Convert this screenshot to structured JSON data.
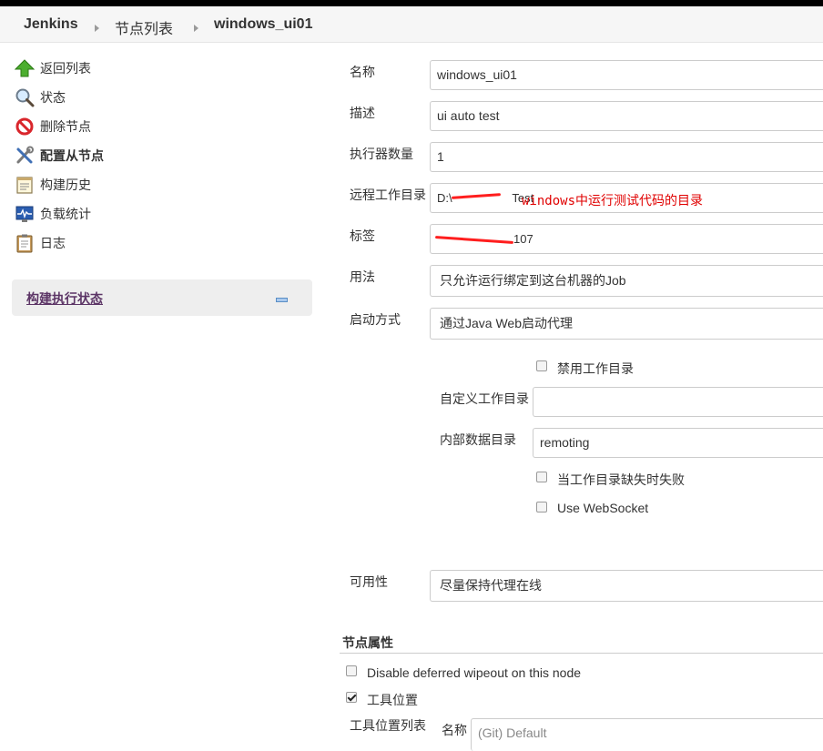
{
  "breadcrumb": {
    "items": [
      "Jenkins",
      "节点列表",
      "windows_ui01"
    ]
  },
  "sidebar": {
    "items": [
      {
        "label": "返回列表",
        "icon": "up-arrow-icon"
      },
      {
        "label": "状态",
        "icon": "magnifier-icon"
      },
      {
        "label": "删除节点",
        "icon": "no-entry-icon"
      },
      {
        "label": "配置从节点",
        "icon": "tools-icon"
      },
      {
        "label": "构建历史",
        "icon": "notepad-icon"
      },
      {
        "label": "负载统计",
        "icon": "monitor-icon"
      },
      {
        "label": "日志",
        "icon": "clipboard-icon"
      }
    ],
    "executor_panel": {
      "title": "构建执行状态"
    }
  },
  "form": {
    "name": {
      "label": "名称",
      "value": "windows_ui01"
    },
    "description": {
      "label": "描述",
      "value": "ui auto test"
    },
    "executors": {
      "label": "执行器数量",
      "value": "1"
    },
    "remote_root": {
      "label": "远程工作目录",
      "value_prefix": "D:\\",
      "value_suffix": "Test",
      "annotation": "windows中运行测试代码的目录"
    },
    "labels": {
      "label": "标签",
      "value_visible": "107"
    },
    "usage": {
      "label": "用法",
      "value": "只允许运行绑定到这台机器的Job"
    },
    "launch": {
      "label": "启动方式",
      "value": "通过Java Web启动代理"
    },
    "disable_workdir": {
      "label": "禁用工作目录",
      "checked": false
    },
    "custom_workdir": {
      "label": "自定义工作目录",
      "value": ""
    },
    "internal_data": {
      "label": "内部数据目录",
      "value": "remoting"
    },
    "fail_if_missing": {
      "label": "当工作目录缺失时失败",
      "checked": false
    },
    "websocket": {
      "label": "Use WebSocket",
      "checked": false
    },
    "availability": {
      "label": "可用性",
      "value": "尽量保持代理在线"
    }
  },
  "node_properties": {
    "title": "节点属性",
    "disable_wipeout": {
      "label": "Disable deferred wipeout on this node",
      "checked": false
    },
    "tool_locations": {
      "label": "工具位置",
      "checked": true
    },
    "tool_list": {
      "label": "工具位置列表",
      "name_label": "名称",
      "name_value": "(Git) Default"
    }
  },
  "colors": {
    "accent_purple": "#5c3566",
    "annotation_red": "#e00000",
    "panel_bg": "#eeeeee"
  }
}
